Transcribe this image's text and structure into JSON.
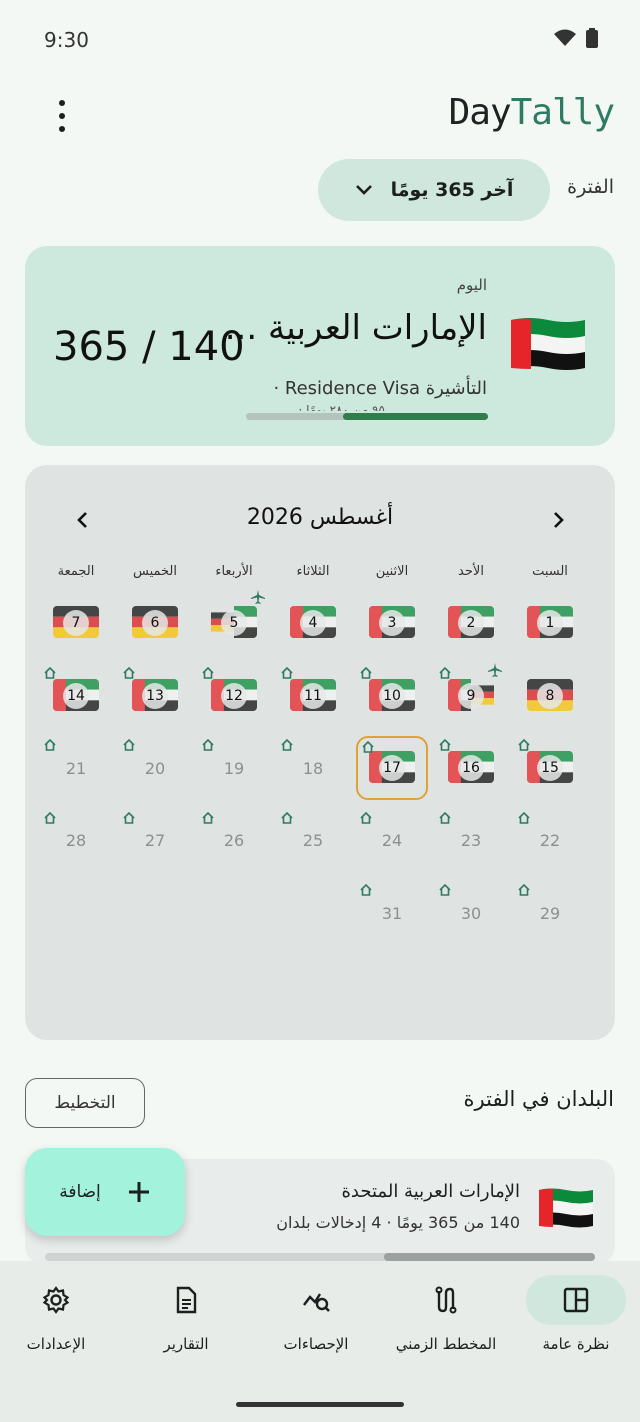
{
  "status_bar": {
    "time": "9:30"
  },
  "app": {
    "logo_part1": "Day",
    "logo_part2": "Tally"
  },
  "period": {
    "label": "الفترة",
    "selected": "آخر 365 يومًا"
  },
  "today_card": {
    "label": "اليوم",
    "country": "الإمارات العربية ...",
    "count": "365 / 140",
    "visa_line": "التأشيرة Residence Visa ·",
    "visa_sub": "· ٩٥ من ٢٨٠ يومًا",
    "progress_fraction": 0.6
  },
  "calendar": {
    "title": "أغسطس 2026",
    "weekdays": [
      "السبت",
      "الأحد",
      "الاثنين",
      "الثلاثاء",
      "الأربعاء",
      "الخميس",
      "الجمعة"
    ],
    "days": [
      {
        "n": "1",
        "flag": "ae"
      },
      {
        "n": "2",
        "flag": "ae"
      },
      {
        "n": "3",
        "flag": "ae"
      },
      {
        "n": "4",
        "flag": "ae"
      },
      {
        "n": "5",
        "flag": "de-ae",
        "plane": true
      },
      {
        "n": "6",
        "flag": "de"
      },
      {
        "n": "7",
        "flag": "de"
      },
      {
        "n": "8",
        "flag": "de"
      },
      {
        "n": "9",
        "flag": "ae-de",
        "plane": true,
        "home": true
      },
      {
        "n": "10",
        "flag": "ae",
        "home": true
      },
      {
        "n": "11",
        "flag": "ae",
        "home": true
      },
      {
        "n": "12",
        "flag": "ae",
        "home": true
      },
      {
        "n": "13",
        "flag": "ae",
        "home": true
      },
      {
        "n": "14",
        "flag": "ae",
        "home": true
      },
      {
        "n": "15",
        "flag": "ae",
        "home": true
      },
      {
        "n": "16",
        "flag": "ae",
        "home": true
      },
      {
        "n": "17",
        "flag": "ae",
        "home": true,
        "today": true
      },
      {
        "n": "18",
        "home": true
      },
      {
        "n": "19",
        "home": true
      },
      {
        "n": "20",
        "home": true
      },
      {
        "n": "21",
        "home": true
      },
      {
        "n": "22",
        "home": true
      },
      {
        "n": "23",
        "home": true
      },
      {
        "n": "24",
        "home": true
      },
      {
        "n": "25",
        "home": true
      },
      {
        "n": "26",
        "home": true
      },
      {
        "n": "27",
        "home": true
      },
      {
        "n": "28",
        "home": true
      },
      {
        "n": "29",
        "home": true
      },
      {
        "n": "30",
        "home": true
      },
      {
        "n": "31",
        "home": true
      }
    ]
  },
  "countries": {
    "title": "البلدان في الفترة",
    "plan_button": "التخطيط",
    "items": [
      {
        "name": "الإمارات العربية المتحدة",
        "meta": "140 من 365 يومًا · 4 إدخالات بلدان",
        "fraction": 0.383
      }
    ]
  },
  "fab": {
    "label": "إضافة"
  },
  "bottom_nav": [
    {
      "label": "نظرة عامة",
      "icon": "overview-icon",
      "active": true
    },
    {
      "label": "المخطط الزمني",
      "icon": "timeline-icon",
      "active": false
    },
    {
      "label": "الإحصاءات",
      "icon": "stats-icon",
      "active": false
    },
    {
      "label": "التقارير",
      "icon": "reports-icon",
      "active": false
    },
    {
      "label": "الإعدادات",
      "icon": "settings-icon",
      "active": false
    }
  ],
  "colors": {
    "accent": "#2f7a63",
    "card_green": "#cde8dc",
    "fab": "#a3f2dc",
    "today_border": "#e0a238"
  }
}
